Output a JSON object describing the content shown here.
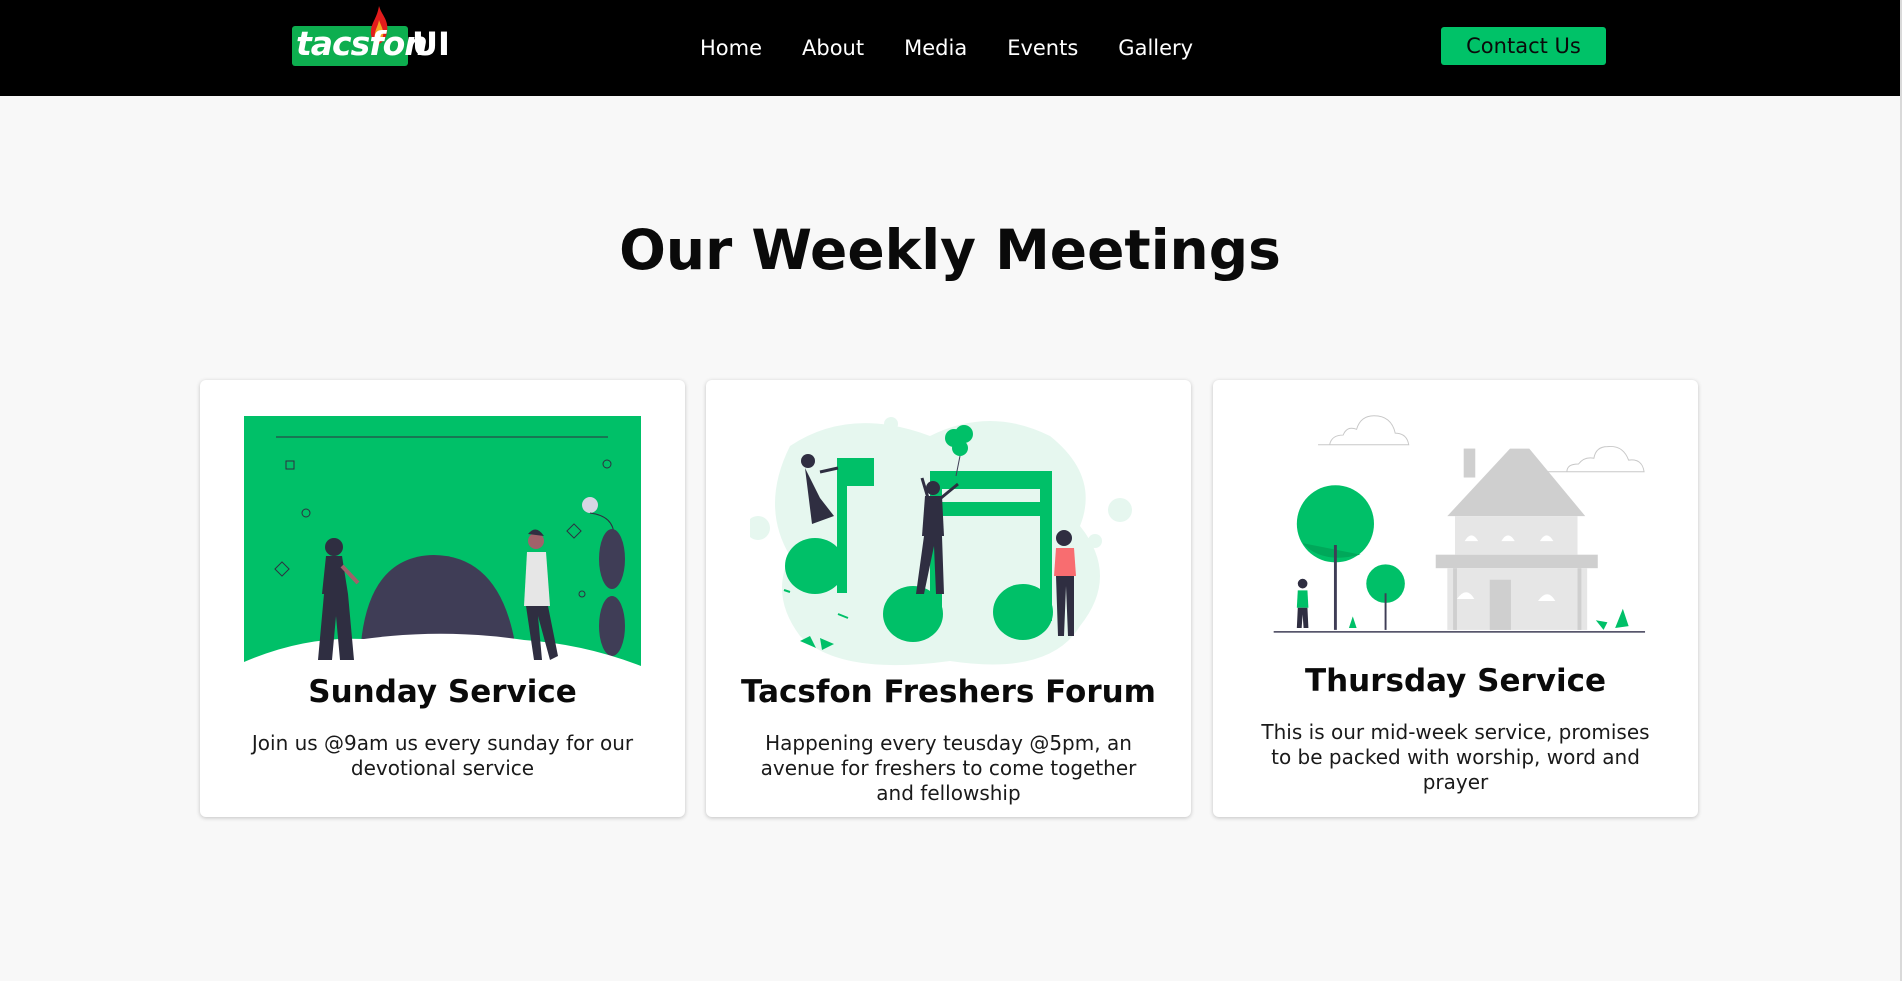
{
  "brand": {
    "logo_word": "tacsfon",
    "logo_suffix": "UI",
    "accent_color": "#00c268",
    "logo_green": "#0dae4f",
    "flame_colors": [
      "#e21c1c",
      "#f5a623"
    ]
  },
  "nav": {
    "items": [
      "Home",
      "About",
      "Media",
      "Events",
      "Gallery"
    ],
    "contact_label": "Contact Us"
  },
  "section": {
    "title": "Our Weekly Meetings"
  },
  "cards": [
    {
      "title": "Sunday Service",
      "text": "Join us @9am us every sunday for our devotional service",
      "illustration": "people-outside-hill-icon"
    },
    {
      "title": "Tacsfon Freshers Forum",
      "text": "Happening every teusday @5pm, an avenue for freshers to come together and fellowship",
      "illustration": "music-notes-people-icon"
    },
    {
      "title": "Thursday Service",
      "text": "This is our mid-week service, promises to be packed with worship, word and prayer",
      "illustration": "house-trees-icon"
    }
  ]
}
